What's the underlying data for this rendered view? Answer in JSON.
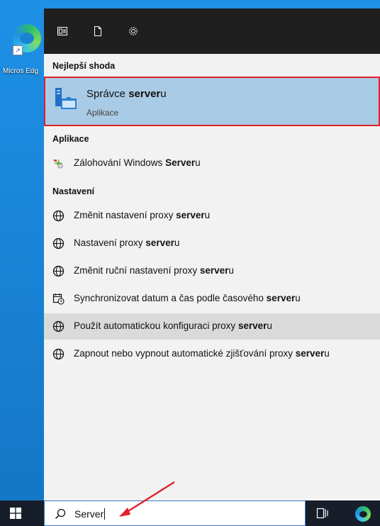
{
  "desktop": {
    "icon_label": "Micros Edg"
  },
  "panel": {
    "toolbar": {
      "apps_icon": "document-list-icon",
      "docs_icon": "document-icon",
      "settings_icon": "gear-icon"
    },
    "best_match": {
      "header": "Nejlepší shoda",
      "title_pre": "Správce ",
      "title_bold": "server",
      "title_post": "u",
      "subtitle": "Aplikace"
    },
    "apps": {
      "header": "Aplikace",
      "items": [
        {
          "pre": "Zálohování Windows ",
          "bold": "Server",
          "post": "u"
        }
      ]
    },
    "settings": {
      "header": "Nastavení",
      "items": [
        {
          "pre": "Změnit nastavení proxy ",
          "bold": "server",
          "post": "u"
        },
        {
          "pre": "Nastavení proxy ",
          "bold": "server",
          "post": "u"
        },
        {
          "pre": "Změnit ruční nastavení proxy ",
          "bold": "server",
          "post": "u"
        },
        {
          "pre": "Synchronizovat datum a čas podle časového ",
          "bold": "server",
          "post": "u"
        },
        {
          "pre": "Použít automatickou konfiguraci proxy ",
          "bold": "server",
          "post": "u"
        },
        {
          "pre": "Zapnout nebo vypnout automatické zjišťování proxy ",
          "bold": "server",
          "post": "u"
        }
      ]
    }
  },
  "taskbar": {
    "search_value": "Server"
  },
  "colors": {
    "highlight": "#a9cbe6",
    "annotation_red": "#e0202a",
    "taskbar": "#171e2a"
  }
}
